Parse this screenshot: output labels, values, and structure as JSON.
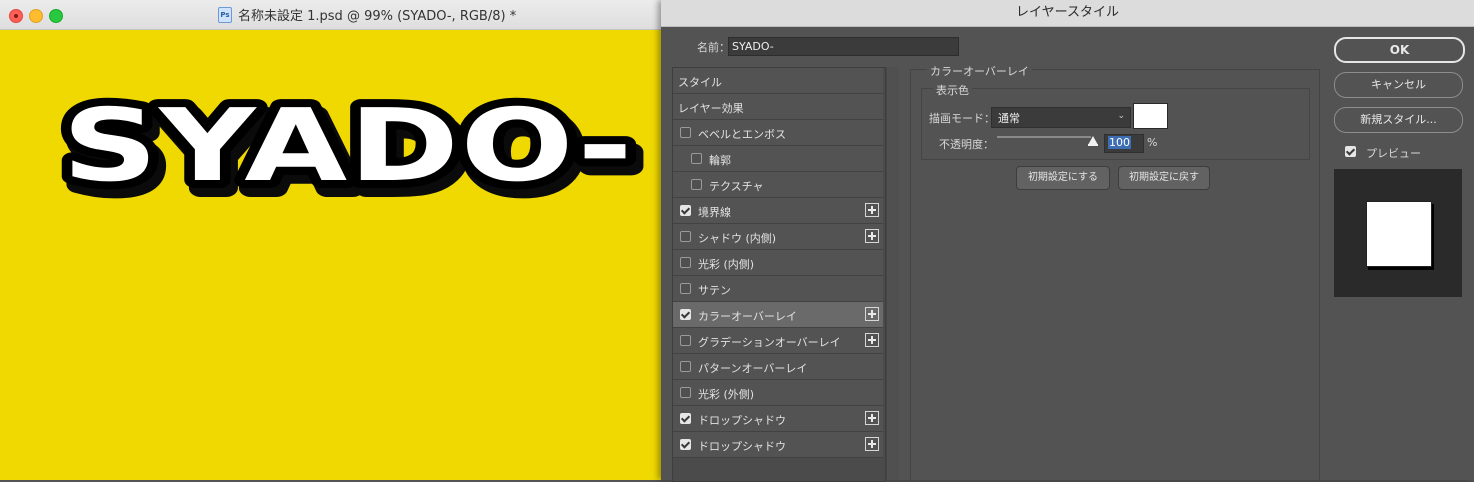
{
  "document": {
    "title": "名称未設定 1.psd @ 99% (SYADO-, RGB/8) *",
    "icon_label": "Ps",
    "canvas_text": "SYADO-",
    "canvas_color": "#efd900"
  },
  "dialog": {
    "title": "レイヤースタイル",
    "name_label": "名前：",
    "name_value": "SYADO-",
    "style_list": [
      {
        "label": "スタイル",
        "checkbox": false,
        "checked": false,
        "indent": false,
        "plus": false,
        "selected": false
      },
      {
        "label": "レイヤー効果",
        "checkbox": false,
        "checked": false,
        "indent": false,
        "plus": false,
        "selected": false
      },
      {
        "label": "ベベルとエンボス",
        "checkbox": true,
        "checked": false,
        "indent": false,
        "plus": false,
        "selected": false
      },
      {
        "label": "輪郭",
        "checkbox": true,
        "checked": false,
        "indent": true,
        "plus": false,
        "selected": false
      },
      {
        "label": "テクスチャ",
        "checkbox": true,
        "checked": false,
        "indent": true,
        "plus": false,
        "selected": false
      },
      {
        "label": "境界線",
        "checkbox": true,
        "checked": true,
        "indent": false,
        "plus": true,
        "selected": false
      },
      {
        "label": "シャドウ (内側)",
        "checkbox": true,
        "checked": false,
        "indent": false,
        "plus": true,
        "selected": false
      },
      {
        "label": "光彩 (内側)",
        "checkbox": true,
        "checked": false,
        "indent": false,
        "plus": false,
        "selected": false
      },
      {
        "label": "サテン",
        "checkbox": true,
        "checked": false,
        "indent": false,
        "plus": false,
        "selected": false
      },
      {
        "label": "カラーオーバーレイ",
        "checkbox": true,
        "checked": true,
        "indent": false,
        "plus": true,
        "selected": true
      },
      {
        "label": "グラデーションオーバーレイ",
        "checkbox": true,
        "checked": false,
        "indent": false,
        "plus": true,
        "selected": false
      },
      {
        "label": "パターンオーバーレイ",
        "checkbox": true,
        "checked": false,
        "indent": false,
        "plus": false,
        "selected": false
      },
      {
        "label": "光彩 (外側)",
        "checkbox": true,
        "checked": false,
        "indent": false,
        "plus": false,
        "selected": false
      },
      {
        "label": "ドロップシャドウ",
        "checkbox": true,
        "checked": true,
        "indent": false,
        "plus": true,
        "selected": false
      },
      {
        "label": "ドロップシャドウ",
        "checkbox": true,
        "checked": true,
        "indent": false,
        "plus": true,
        "selected": false
      }
    ],
    "panel": {
      "section_title": "カラーオーバーレイ",
      "group_title": "表示色",
      "blend_mode_label": "描画モード：",
      "blend_mode_value": "通常",
      "overlay_color": "#ffffff",
      "opacity_label": "不透明度：",
      "opacity_value": "100",
      "opacity_unit": "%",
      "opacity_fraction": 1.0,
      "make_default_label": "初期設定にする",
      "reset_default_label": "初期設定に戻す"
    },
    "buttons": {
      "ok": "OK",
      "cancel": "キャンセル",
      "new_style": "新規スタイル..."
    },
    "preview_label": "プレビュー",
    "preview_checked": true
  }
}
